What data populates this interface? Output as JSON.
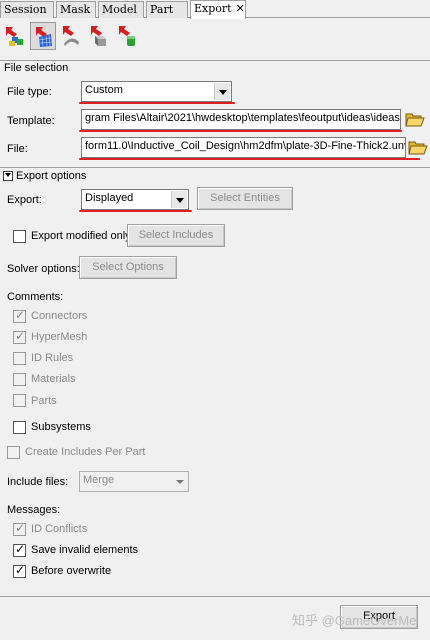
{
  "tabs": [
    {
      "label": "Session"
    },
    {
      "label": "Mask"
    },
    {
      "label": "Model"
    },
    {
      "label": "Part"
    },
    {
      "label": "Export",
      "close": "✕"
    }
  ],
  "toolbar": {
    "icons": [
      "export-components-icon",
      "export-fe-icon",
      "export-geometry-icon",
      "export-solid-icon",
      "export-tcl-icon"
    ],
    "active_index": 1
  },
  "file_selection": {
    "title": "File selection",
    "file_type_label": "File type:",
    "file_type_value": "Custom",
    "template_label": "Template:",
    "template_value": "gram Files\\Altair\\2021\\hwdesktop\\templates\\feoutput\\ideas\\ideas",
    "file_label": "File:",
    "file_value": "form11.0\\Inductive_Coil_Design\\hm2dfm\\plate-3D-Fine-Thick2.unv"
  },
  "export_options": {
    "title": "Export options",
    "export_label": "Export:",
    "export_value": "Displayed",
    "select_entities_label": "Select Entities",
    "export_modified_only_label": "Export modified only",
    "export_modified_only_checked": false,
    "select_includes_label": "Select Includes",
    "solver_options_label": "Solver options:",
    "select_options_label": "Select Options"
  },
  "comments": {
    "title": "Comments:",
    "items": [
      {
        "label": "Connectors",
        "checked": true,
        "disabled": true
      },
      {
        "label": "HyperMesh",
        "checked": true,
        "disabled": true
      },
      {
        "label": "ID Rules",
        "checked": false,
        "disabled": true
      },
      {
        "label": "Materials",
        "checked": false,
        "disabled": true
      },
      {
        "label": "Parts",
        "checked": false,
        "disabled": true
      },
      {
        "label": "Subsystems",
        "checked": false,
        "disabled": false
      }
    ]
  },
  "create_includes_per_part": {
    "label": "Create Includes Per Part",
    "checked": false,
    "disabled": true
  },
  "include_files": {
    "label": "Include files:",
    "value": "Merge"
  },
  "messages": {
    "title": "Messages:",
    "items": [
      {
        "label": "ID Conflicts",
        "checked": true,
        "disabled": true
      },
      {
        "label": "Save invalid elements",
        "checked": true,
        "disabled": false
      },
      {
        "label": "Before overwrite",
        "checked": true,
        "disabled": false
      }
    ]
  },
  "export_button_label": "Export",
  "watermark": "知乎 @GameOverMe",
  "colors": {
    "annotation_red": "#e02020",
    "panel_bg": "#f0f0f0"
  }
}
